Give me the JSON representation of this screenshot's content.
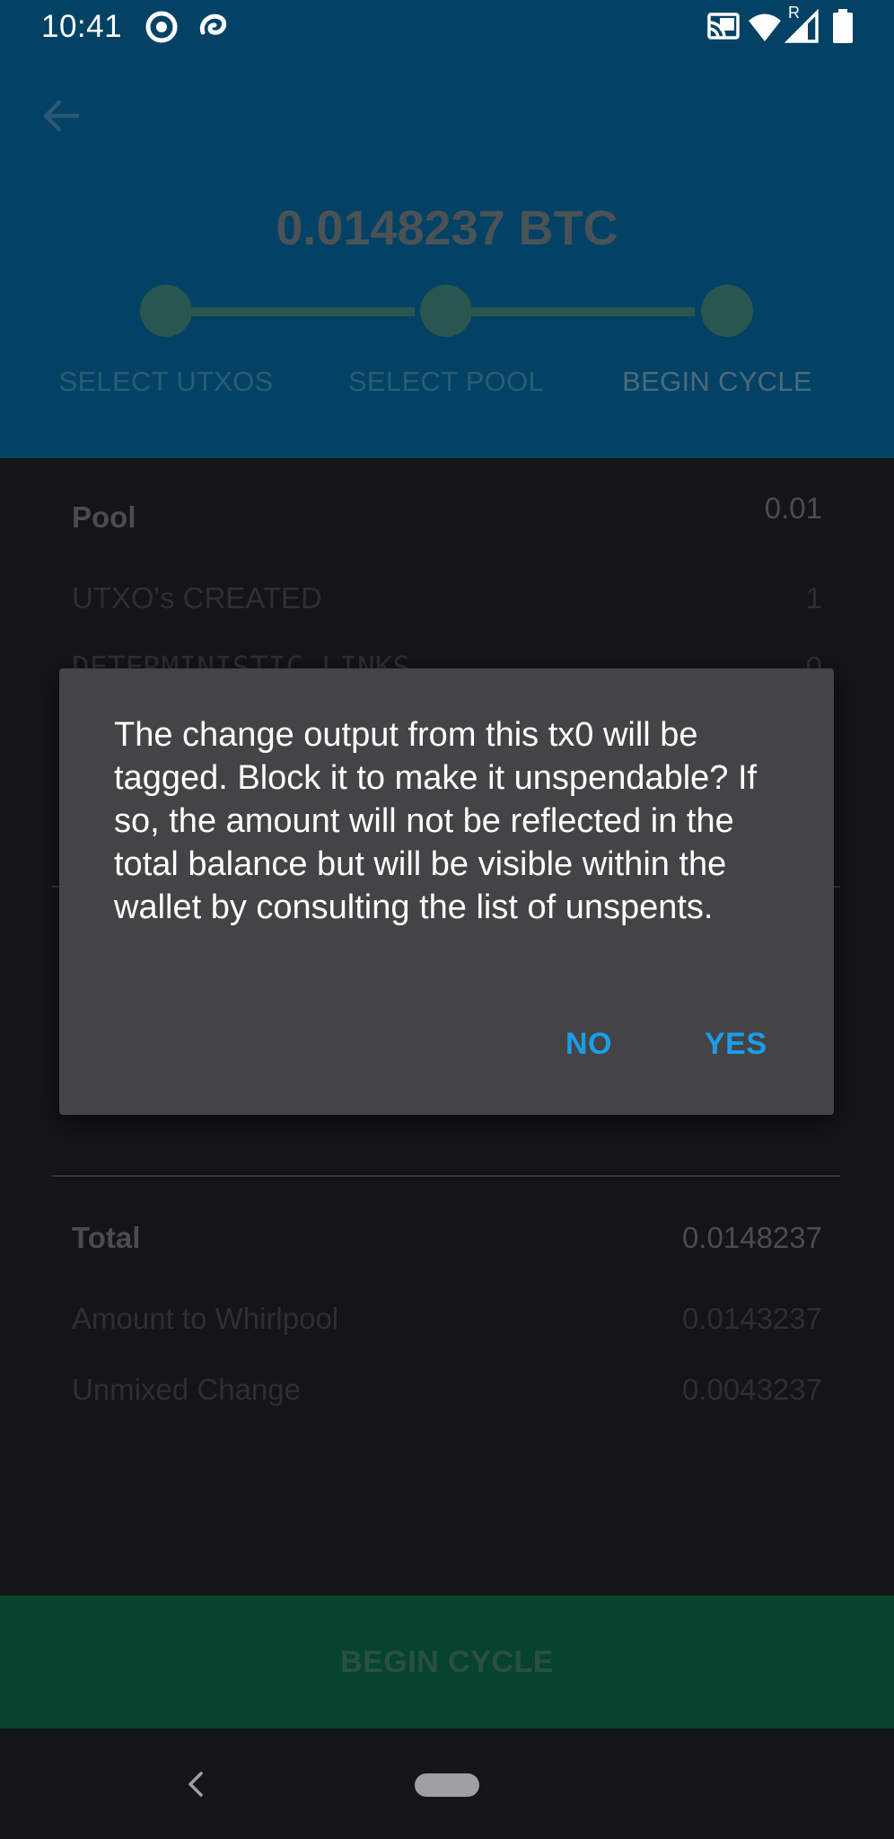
{
  "status_bar": {
    "time": "10:41",
    "left_icons": [
      "at-sign-icon",
      "swirl-icon"
    ],
    "right_icons": [
      "cast-icon",
      "wifi-icon",
      "signal-icon",
      "battery-icon"
    ],
    "signal_roaming_label": "R"
  },
  "header": {
    "amount": "0.0148237 BTC",
    "steps": [
      {
        "label": "SELECT UTXOS",
        "active": false
      },
      {
        "label": "SELECT POOL",
        "active": false
      },
      {
        "label": "BEGIN CYCLE",
        "active": true
      }
    ]
  },
  "details": {
    "pool_label": "Pool",
    "pool_value": "0.01",
    "utxos_created_label": "UTXO's CREATED",
    "utxos_created_value": "1",
    "deterministic_links_label": "DETERMINISTIC LINKS",
    "deterministic_links_value": "0",
    "total_label": "Total",
    "total_value": "0.0148237",
    "amount_to_whirlpool_label": "Amount to Whirlpool",
    "amount_to_whirlpool_value": "0.0143237",
    "unmixed_change_label": "Unmixed Change",
    "unmixed_change_value": "0.0043237"
  },
  "dialog": {
    "message": "The change output from this tx0 will be tagged. Block it to make it unspendable? If so, the amount will not be reflected in the total balance but will be visible within the wallet by consulting the list of unspents.",
    "no_label": "NO",
    "yes_label": "YES",
    "accent_color": "#1a9ee8"
  },
  "cta": {
    "label": "BEGIN CYCLE"
  },
  "colors": {
    "header_bg": "#034265",
    "body_bg": "#141517",
    "cta_bg": "#06442d",
    "dialog_bg": "#444446"
  }
}
